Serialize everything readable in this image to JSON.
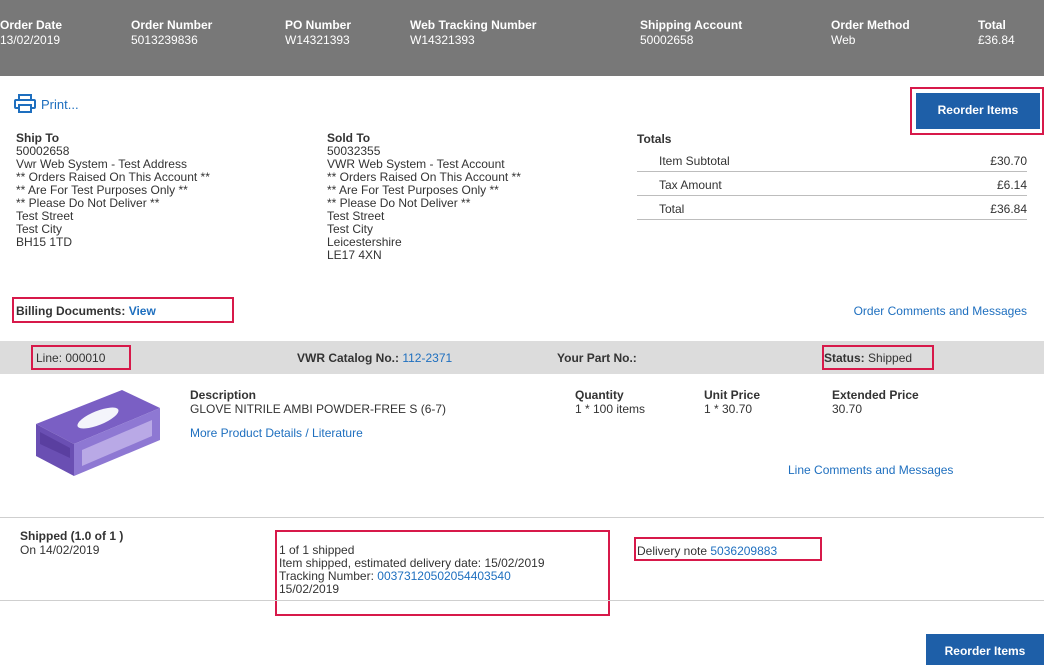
{
  "header": {
    "order_date": {
      "label": "Order Date",
      "value": "13/02/2019"
    },
    "order_number": {
      "label": "Order Number",
      "value": "5013239836"
    },
    "po_number": {
      "label": "PO Number",
      "value": "W14321393"
    },
    "web_tracking": {
      "label": "Web Tracking Number",
      "value": "W14321393"
    },
    "shipping_account": {
      "label": "Shipping Account",
      "value": "50002658"
    },
    "order_method": {
      "label": "Order Method",
      "value": "Web"
    },
    "total": {
      "label": "Total",
      "value": "£36.84"
    }
  },
  "print_label": "Print...",
  "reorder_label": "Reorder Items",
  "ship_to": {
    "title": "Ship To",
    "lines": [
      "50002658",
      "Vwr Web System - Test Address",
      "** Orders Raised On This Account **",
      "** Are For Test Purposes Only **",
      "** Please Do Not Deliver **",
      "Test Street",
      "Test City",
      "BH15 1TD"
    ]
  },
  "sold_to": {
    "title": "Sold To",
    "lines": [
      "50032355",
      "VWR Web System - Test Account",
      "** Orders Raised On This Account **",
      "** Are For Test Purposes Only **",
      "** Please Do Not Deliver **",
      "Test Street",
      "Test City",
      "Leicestershire",
      "LE17 4XN"
    ]
  },
  "totals": {
    "title": "Totals",
    "item_subtotal": {
      "label": "Item Subtotal",
      "value": "£30.70"
    },
    "tax_amount": {
      "label": "Tax Amount",
      "value": "£6.14"
    },
    "total": {
      "label": "Total",
      "value": "£36.84"
    }
  },
  "billing": {
    "label": "Billing Documents:",
    "link": "View"
  },
  "order_comments": "Order Comments and Messages",
  "line": {
    "line_label": "Line: 000010",
    "catalog_label": "VWR Catalog No.:",
    "catalog_value": "112-2371",
    "part_label": "Your Part No.:",
    "status_label": "Status:",
    "status_value": "Shipped"
  },
  "product": {
    "description_header": "Description",
    "description": "GLOVE NITRILE AMBI POWDER-FREE S (6-7)",
    "more_details": "More Product Details / Literature",
    "quantity_header": "Quantity",
    "quantity": "1 * 100 items",
    "unit_price_header": "Unit Price",
    "unit_price": "1 * 30.70",
    "extended_price_header": "Extended Price",
    "extended_price": "30.70",
    "line_comments": "Line Comments and Messages"
  },
  "shipment": {
    "title": "Shipped (1.0 of 1 )",
    "date": "On 14/02/2019",
    "status": "1 of 1 shipped",
    "estimate": "Item shipped, estimated delivery date: 15/02/2019",
    "tracking_label": "Tracking Number:",
    "tracking_value": "00373120502054403540",
    "tracking_date": "15/02/2019",
    "delivery_label": "Delivery note",
    "delivery_value": "5036209883"
  },
  "colors": {
    "header_bg": "#787878",
    "accent": "#1e5fa8",
    "link": "#1e6fbf",
    "highlight": "#d7194a"
  }
}
